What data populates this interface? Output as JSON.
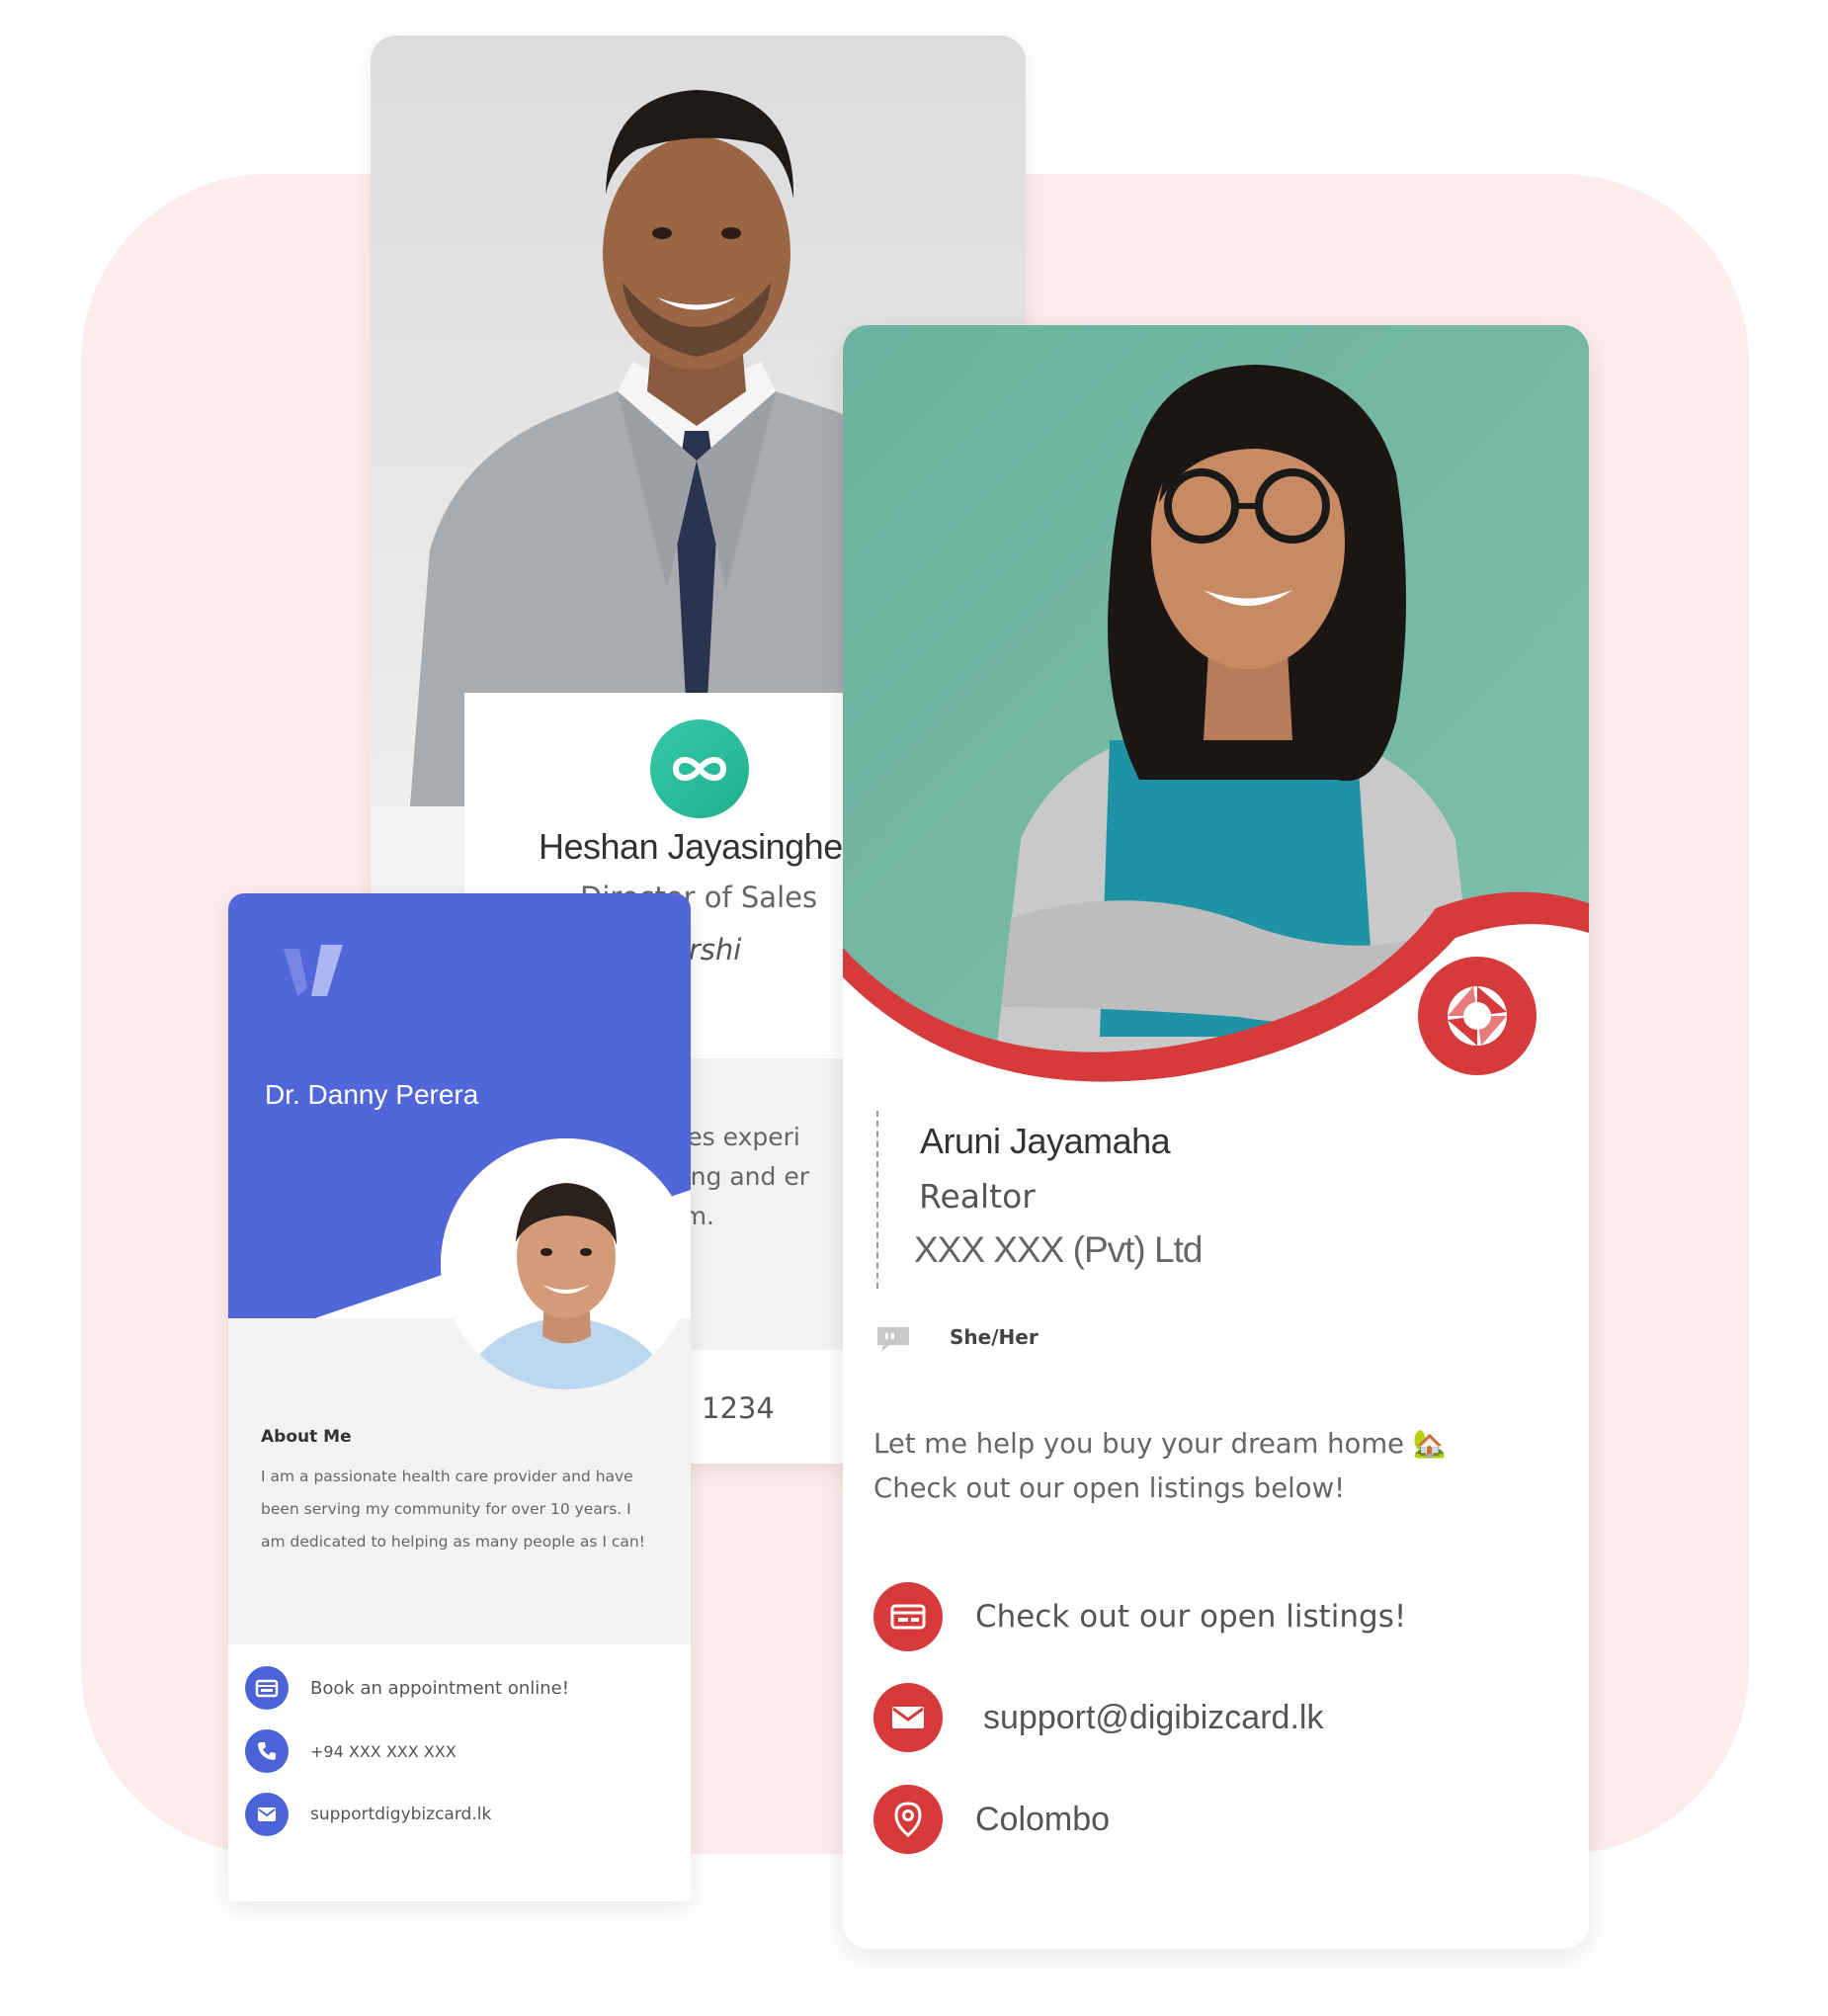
{
  "card_heshan": {
    "name": "Heshan Jayasinghe",
    "role_visible": "Director of Sales",
    "company_visible": "Dealershi",
    "bio_lines": [
      "sales experi",
      "pping and er",
      "eam."
    ],
    "phone_visible": "1234",
    "logo_icon": "infinity-icon",
    "accent_color": "#2bbd9b"
  },
  "card_danny": {
    "name": "Dr. Danny Perera",
    "about_title": "About Me",
    "about_text": "I am a passionate health care provider and have been serving my community for over 10 years. I am dedicated to helping as many people as I can!",
    "actions": [
      {
        "label": "Book an appointment online!",
        "icon": "calendar-icon"
      },
      {
        "label": "+94 XXX XXX XXX",
        "icon": "phone-icon"
      },
      {
        "label": "supportdigybizcard.lk",
        "icon": "mail-icon"
      }
    ],
    "accent_color": "#4a63d6"
  },
  "card_aruni": {
    "name": "Aruni Jayamaha",
    "title": "Realtor",
    "company": "XXX XXX (Pvt) Ltd",
    "pronouns": "She/Her",
    "bio_line1": "Let me help you buy your dream home 🏡",
    "bio_line2": "Check out our open listings below!",
    "actions": [
      {
        "label": "Check out our open listings!",
        "icon": "listing-icon"
      },
      {
        "label": "support@digibizcard.lk",
        "icon": "mail-icon"
      },
      {
        "label": "Colombo",
        "icon": "location-pin-icon"
      }
    ],
    "accent_color": "#d63a3a"
  }
}
